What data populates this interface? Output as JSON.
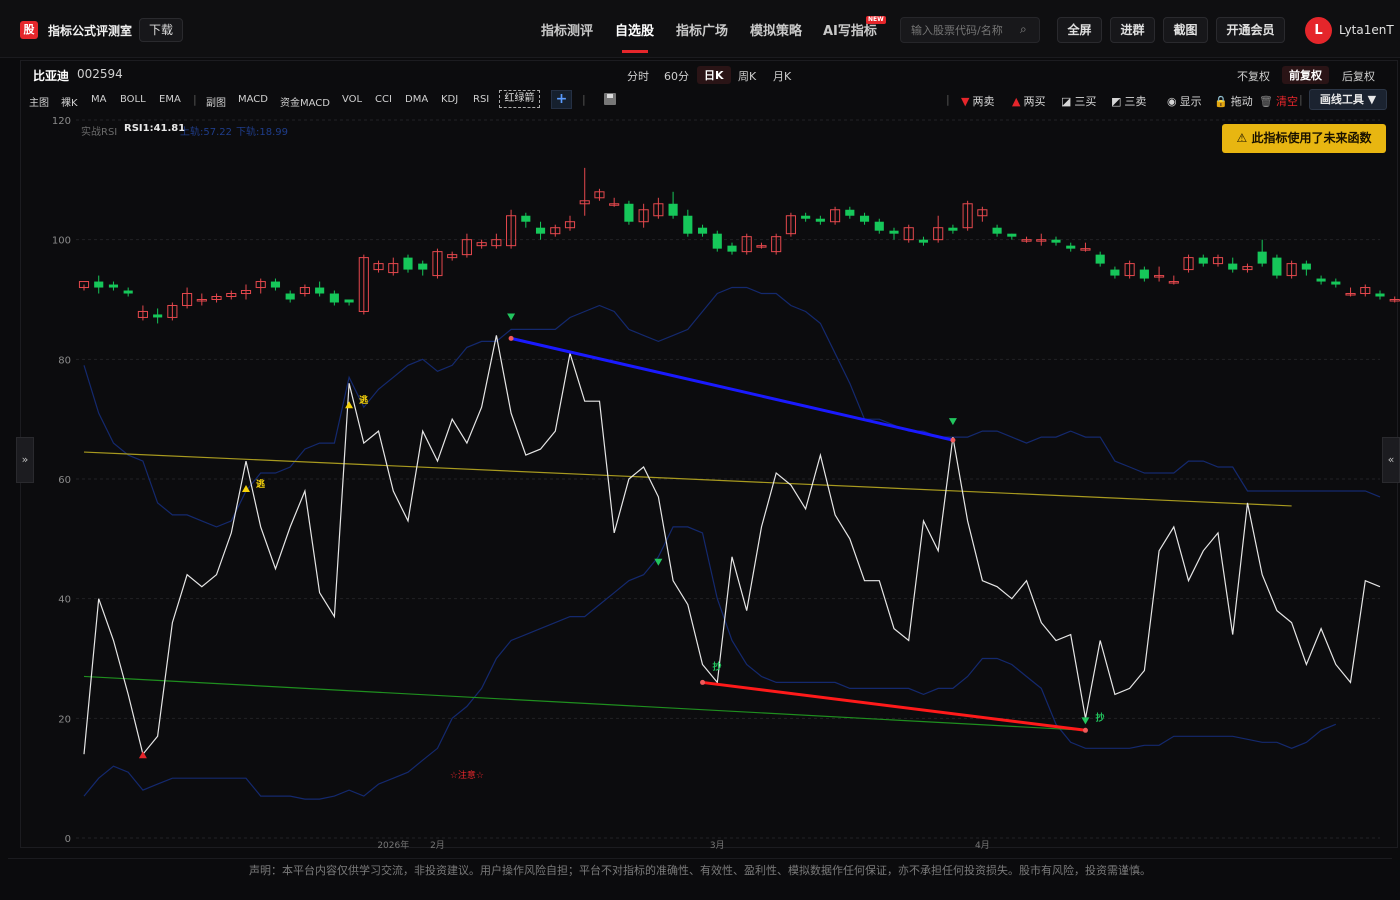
{
  "app": {
    "logo_char": "股",
    "title": "指标公式评测室",
    "download_label": "下载"
  },
  "nav": {
    "items": [
      {
        "label": "指标测评",
        "active": false
      },
      {
        "label": "自选股",
        "active": true
      },
      {
        "label": "指标广场",
        "active": false
      },
      {
        "label": "模拟策略",
        "active": false
      },
      {
        "label": "AI写指标",
        "active": false,
        "badge": "NEW"
      }
    ]
  },
  "search": {
    "placeholder": "输入股票代码/名称"
  },
  "toolbar": {
    "fullscreen": "全屏",
    "join_group": "进群",
    "screenshot": "截图",
    "vip": "开通会员"
  },
  "user": {
    "initial": "L",
    "name": "Lyta1enT"
  },
  "stock": {
    "name": "比亚迪",
    "code": "002594"
  },
  "periods": [
    {
      "label": "分时",
      "active": false
    },
    {
      "label": "60分",
      "active": false
    },
    {
      "label": "日K",
      "active": true
    },
    {
      "label": "周K",
      "active": false
    },
    {
      "label": "月K",
      "active": false
    }
  ],
  "adjust": [
    {
      "label": "不复权",
      "active": false
    },
    {
      "label": "前复权",
      "active": true
    },
    {
      "label": "后复权",
      "active": false
    }
  ],
  "indicators_main": [
    "主图",
    "裸K",
    "MA",
    "BOLL",
    "EMA"
  ],
  "indicators_sub": [
    "副图",
    "MACD",
    "资金MACD",
    "VOL",
    "CCI",
    "DMA",
    "KDJ",
    "RSI"
  ],
  "dashed_button": "红绿箭",
  "plus_label": "+",
  "tools": [
    {
      "icon": "▼",
      "color": "#e5262b",
      "label": "两卖",
      "name": "tool-two-sell"
    },
    {
      "icon": "▲",
      "color": "#e5262b",
      "label": "两买",
      "name": "tool-two-buy"
    },
    {
      "icon": "◪",
      "color": "#d6d6d6",
      "label": "三买",
      "name": "tool-three-buy"
    },
    {
      "icon": "◩",
      "color": "#d6d6d6",
      "label": "三卖",
      "name": "tool-three-sell"
    },
    {
      "icon": "◉",
      "color": "#d6d6d6",
      "label": "显示",
      "name": "tool-show"
    },
    {
      "icon": "🔒",
      "color": "#e8b611",
      "label": "拖动",
      "name": "tool-drag"
    },
    {
      "icon": "🗑",
      "color": "#888",
      "label": "清空",
      "name": "tool-clear",
      "label_color": "#e5262b"
    }
  ],
  "draw_tool_label": "画线工具 ▼",
  "warning": "此指标使用了未来函数",
  "rsi_legend": {
    "name": "实战RSI",
    "rsi": "RSI1:41.81",
    "upper": "上轨:57.22",
    "lower": "下轨:18.99"
  },
  "chart_data": {
    "type": "line",
    "y_axis": {
      "min": 0,
      "max": 120,
      "ticks": [
        0,
        20,
        40,
        60,
        80,
        100,
        120
      ]
    },
    "x_labels": [
      {
        "label": "2026年",
        "index": 21
      },
      {
        "label": "2月",
        "index": 24
      },
      {
        "label": "3月",
        "index": 43
      },
      {
        "label": "4月",
        "index": 61
      }
    ],
    "candles": [
      [
        92,
        93,
        91.5,
        92.5
      ],
      [
        93,
        92,
        91,
        94
      ],
      [
        92.5,
        92,
        91.5,
        93
      ],
      [
        91.5,
        91,
        90.5,
        92
      ],
      [
        87,
        88,
        86.5,
        89
      ],
      [
        87.5,
        87,
        86,
        88.5
      ],
      [
        87,
        89,
        86.5,
        89.5
      ],
      [
        89,
        91,
        88.5,
        92
      ],
      [
        90,
        90,
        89,
        91
      ],
      [
        90,
        90.5,
        89.5,
        91
      ],
      [
        90.5,
        91,
        90,
        91.5
      ],
      [
        91,
        91.5,
        90,
        92.5
      ],
      [
        92,
        93,
        91,
        93.5
      ],
      [
        93,
        92,
        91.5,
        93.5
      ],
      [
        91,
        90,
        89.5,
        91.5
      ],
      [
        91,
        92,
        90.5,
        92.5
      ],
      [
        92,
        91,
        90.5,
        93
      ],
      [
        91,
        89.5,
        89,
        91.5
      ],
      [
        90,
        89.5,
        89,
        90
      ],
      [
        88,
        97,
        87.5,
        97.5
      ],
      [
        95,
        96,
        94.5,
        96.5
      ],
      [
        94.5,
        96,
        94,
        97
      ],
      [
        97,
        95,
        94.5,
        97.5
      ],
      [
        96,
        95,
        94,
        96.5
      ],
      [
        94,
        98,
        93.5,
        98.5
      ],
      [
        97,
        97.5,
        96.5,
        98
      ],
      [
        97.5,
        100,
        97,
        101
      ],
      [
        99,
        99.5,
        98.5,
        100
      ],
      [
        99,
        100,
        98.5,
        101
      ],
      [
        99,
        104,
        98.5,
        105
      ],
      [
        104,
        103,
        102,
        104.5
      ],
      [
        102,
        101,
        100,
        103
      ],
      [
        101,
        102,
        100.5,
        102.5
      ],
      [
        102,
        103,
        101.5,
        104
      ],
      [
        106,
        106.5,
        104,
        112
      ],
      [
        107,
        108,
        106.5,
        108.5
      ],
      [
        106,
        106,
        105.5,
        107
      ],
      [
        106,
        103,
        102.5,
        106.5
      ],
      [
        103,
        105,
        102,
        106
      ],
      [
        104,
        106,
        103.5,
        107
      ],
      [
        106,
        104,
        103.5,
        108
      ],
      [
        104,
        101,
        100.5,
        105
      ],
      [
        102,
        101,
        100.5,
        102.5
      ],
      [
        101,
        98.5,
        98,
        101.5
      ],
      [
        99,
        98,
        97.5,
        99.5
      ],
      [
        98,
        100.5,
        97.5,
        101
      ],
      [
        99,
        99,
        98.5,
        99.5
      ],
      [
        98,
        100.5,
        97.5,
        101
      ],
      [
        101,
        104,
        100.5,
        104.5
      ],
      [
        104,
        103.5,
        103,
        104.5
      ],
      [
        103.5,
        103,
        102.5,
        104
      ],
      [
        103,
        105,
        102.5,
        105.5
      ],
      [
        105,
        104,
        103.5,
        105.5
      ],
      [
        104,
        103,
        102.5,
        104.5
      ],
      [
        103,
        101.5,
        101,
        103.5
      ],
      [
        101.5,
        101,
        100,
        102
      ],
      [
        100,
        102,
        99.5,
        102.5
      ],
      [
        100,
        99.5,
        99,
        100.5
      ],
      [
        100,
        102,
        99.5,
        104
      ],
      [
        102,
        101.5,
        101,
        102.5
      ],
      [
        102,
        106,
        101.5,
        106.5
      ],
      [
        104,
        105,
        103,
        105.5
      ],
      [
        102,
        101,
        100.5,
        102.5
      ],
      [
        101,
        100.5,
        100,
        101
      ],
      [
        100,
        100,
        99.5,
        100.5
      ],
      [
        100,
        100,
        99,
        101
      ],
      [
        100,
        99.5,
        99,
        100.5
      ],
      [
        99,
        98.5,
        98,
        99.5
      ],
      [
        98.5,
        98.5,
        98,
        99.5
      ],
      [
        97.5,
        96,
        95.5,
        98
      ],
      [
        95,
        94,
        93.5,
        95.5
      ],
      [
        94,
        96,
        93.5,
        96.5
      ],
      [
        95,
        93.5,
        93,
        95.5
      ],
      [
        94,
        94,
        93,
        95.5
      ],
      [
        93,
        93,
        92.5,
        94
      ],
      [
        95,
        97,
        94.5,
        97.5
      ],
      [
        97,
        96,
        95.5,
        97.5
      ],
      [
        96,
        97,
        95.5,
        97.5
      ],
      [
        96,
        95,
        94.5,
        97
      ],
      [
        95,
        95.5,
        94.5,
        96
      ],
      [
        98,
        96,
        95.5,
        100
      ],
      [
        97,
        94,
        93.5,
        97.5
      ],
      [
        94,
        96,
        93.5,
        96.5
      ],
      [
        96,
        95,
        94,
        96.5
      ],
      [
        93.5,
        93,
        92.5,
        94
      ],
      [
        93,
        92.5,
        92,
        93.5
      ],
      [
        91,
        91,
        90.5,
        92
      ],
      [
        91,
        92,
        90.5,
        92.5
      ],
      [
        91,
        90.5,
        90,
        91.5
      ],
      [
        90,
        90,
        89.5,
        90.5
      ],
      [
        90,
        91.5,
        89.5,
        92
      ],
      [
        91.5,
        91,
        90.5,
        92
      ]
    ],
    "rsi": [
      14,
      40,
      33,
      24,
      14,
      17,
      36,
      44,
      42,
      44,
      51,
      63,
      52,
      45,
      52,
      58,
      41,
      37,
      76,
      66,
      68,
      58,
      53,
      68,
      63,
      70,
      66,
      72,
      84,
      71,
      64,
      65,
      68,
      81,
      73,
      73,
      51,
      60,
      62,
      57,
      43,
      39,
      29,
      26,
      47,
      38,
      52,
      61,
      59,
      55,
      64,
      54,
      50,
      43,
      43,
      35,
      33,
      53,
      48,
      67,
      53,
      43,
      42,
      40,
      43,
      36,
      33,
      34,
      20,
      33,
      24,
      25,
      28,
      48,
      52,
      43,
      48,
      51,
      34,
      56,
      44,
      38,
      36,
      29,
      35,
      29,
      26,
      43,
      42
    ],
    "upper_band": [
      79,
      71,
      66,
      64,
      63,
      56,
      54,
      54,
      53,
      52,
      53,
      58,
      61,
      61,
      62,
      65,
      66,
      66,
      77,
      72,
      75,
      77,
      79,
      80,
      78,
      79,
      82,
      83,
      83,
      85,
      85,
      85,
      85,
      87,
      88,
      89,
      88,
      85,
      84,
      83,
      84,
      85,
      88,
      91,
      92,
      92,
      91,
      91,
      89,
      88,
      86,
      81,
      76,
      70,
      70,
      69,
      68,
      68,
      67,
      67,
      67,
      68,
      68,
      67,
      66,
      67,
      67,
      68,
      67,
      67,
      63,
      62,
      61,
      61,
      61,
      63,
      63,
      62,
      62,
      58,
      58,
      58,
      58,
      58,
      58,
      58,
      58,
      58,
      57
    ],
    "lower_band": [
      7,
      10,
      12,
      11,
      8,
      9,
      10,
      10,
      10,
      10,
      10,
      10,
      7,
      7,
      7,
      6.5,
      6.5,
      7,
      8,
      7,
      9,
      10,
      11,
      13,
      15,
      20,
      22,
      25,
      30,
      33,
      34,
      35,
      36,
      37,
      37,
      39,
      41,
      43,
      44,
      47,
      52,
      52,
      51,
      40,
      33,
      29,
      27,
      26,
      26,
      26,
      26,
      26,
      25,
      25,
      25,
      25,
      25,
      24,
      25,
      25,
      27,
      30,
      30,
      29,
      27,
      25,
      19,
      16,
      15,
      15,
      15,
      15,
      15.5,
      15.5,
      17,
      17,
      17,
      17,
      17,
      16.5,
      16,
      16,
      15,
      16,
      18,
      19
    ],
    "yellow_line": [
      [
        0,
        64.5
      ],
      [
        82,
        55.5
      ]
    ],
    "green_line": [
      [
        0,
        27
      ],
      [
        68,
        18
      ]
    ],
    "blue_line": [
      [
        29,
        83.5
      ],
      [
        59,
        66.5
      ]
    ],
    "red_line": [
      [
        42,
        26
      ],
      [
        68,
        18
      ]
    ],
    "markers": [
      {
        "index": 4,
        "value": 14,
        "shape": "up",
        "color": "#e5262b"
      },
      {
        "index": 11,
        "value": 58.5,
        "shape": "up",
        "color": "#f5d20b",
        "label": "逃"
      },
      {
        "index": 18,
        "value": 72.5,
        "shape": "up",
        "color": "#f5d20b",
        "label": "逃"
      },
      {
        "index": 29,
        "value": 87,
        "shape": "down",
        "color": "#22c55e"
      },
      {
        "index": 59,
        "value": 69.5,
        "shape": "down",
        "color": "#22c55e"
      },
      {
        "index": 39,
        "value": 46,
        "shape": "down",
        "color": "#22c55e"
      },
      {
        "index": 42,
        "value": 28,
        "shape": "none",
        "color": "#22c55e",
        "label": "抄"
      },
      {
        "index": 68,
        "value": 19.5,
        "shape": "down",
        "color": "#22c55e",
        "label": "抄"
      }
    ],
    "note_label": {
      "index": 26,
      "value": 10,
      "text": "☆注意☆"
    }
  },
  "footer": "声明：本平台内容仅供学习交流，非投资建议。用户操作风险自担；平台不对指标的准确性、有效性、盈利性、模拟数据作任何保证，亦不承担任何投资损失。股市有风险，投资需谨慎。"
}
